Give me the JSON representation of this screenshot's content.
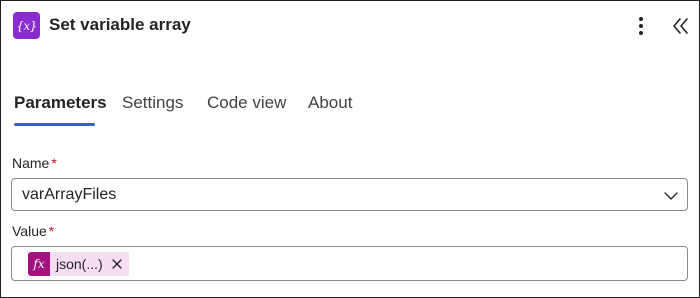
{
  "header": {
    "icon_glyph": "{x}",
    "icon_name": "variable-icon",
    "title": "Set variable array",
    "more_icon": "more-vertical-icon",
    "collapse_icon": "double-chevron-left-icon"
  },
  "tabs": [
    {
      "label": "Parameters",
      "active": true
    },
    {
      "label": "Settings",
      "active": false
    },
    {
      "label": "Code view",
      "active": false
    },
    {
      "label": "About",
      "active": false
    }
  ],
  "form": {
    "name": {
      "label": "Name",
      "required_mark": "*",
      "value": "varArrayFiles",
      "dropdown_icon": "chevron-down-icon"
    },
    "value": {
      "label": "Value",
      "required_mark": "*",
      "token": {
        "icon_glyph": "fx",
        "icon_name": "function-icon",
        "text": "json(...)",
        "remove_icon": "close-icon"
      }
    }
  },
  "colors": {
    "brand_purple": "#8A2BD0",
    "tab_accent": "#3B5BDB",
    "token_icon_bg": "#A5117F",
    "token_bg": "#F6DDEF",
    "required": "#C50F1F"
  }
}
